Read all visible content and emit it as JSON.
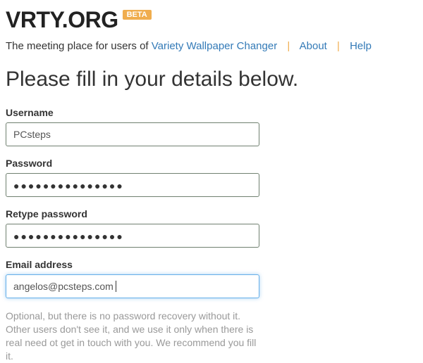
{
  "header": {
    "site_name": "VRTY.ORG",
    "beta_badge": "BETA"
  },
  "tagline": {
    "prefix": "The meeting place for users of ",
    "app_link": "Variety Wallpaper Changer",
    "nav": {
      "about": "About",
      "help": "Help"
    }
  },
  "page_title": "Please fill in your details below.",
  "form": {
    "username": {
      "label": "Username",
      "value": "PCsteps"
    },
    "password": {
      "label": "Password",
      "mask": "●●●●●●●●●●●●●●●"
    },
    "password2": {
      "label": "Retype password",
      "mask": "●●●●●●●●●●●●●●●"
    },
    "email": {
      "label": "Email address",
      "value": "angelos@pcsteps.com",
      "help": "Optional, but there is no password recovery without it. Other users don't see it, and we use it only when there is real need ot get in touch with you. We recommend you fill it."
    }
  }
}
